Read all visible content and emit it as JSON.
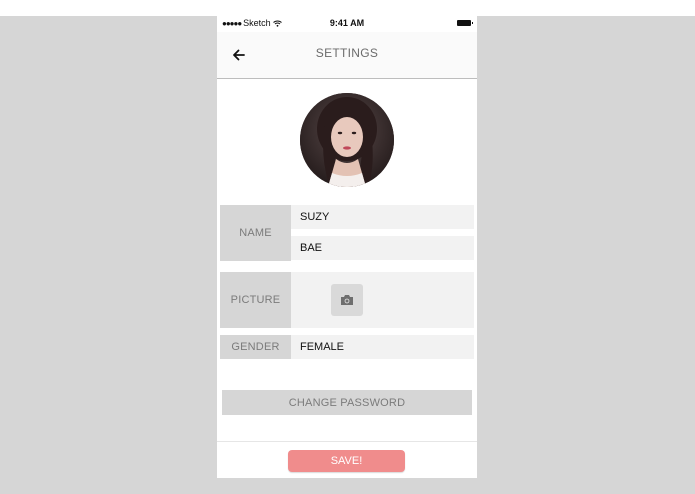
{
  "status_bar": {
    "carrier": "Sketch",
    "time": "9:41 AM"
  },
  "navbar": {
    "title": "SETTINGS"
  },
  "form": {
    "name_label": "NAME",
    "first_name": "SUZY",
    "last_name": "BAE",
    "picture_label": "PICTURE",
    "gender_label": "GENDER",
    "gender_value": "FEMALE"
  },
  "actions": {
    "change_password": "CHANGE PASSWORD",
    "save": "SAVE!"
  },
  "colors": {
    "save_button": "#f08c8c",
    "label_bg": "#d6d6d6",
    "field_bg": "#f2f2f2"
  },
  "icons": [
    "back-arrow-icon",
    "camera-icon",
    "wifi-icon",
    "battery-icon"
  ]
}
